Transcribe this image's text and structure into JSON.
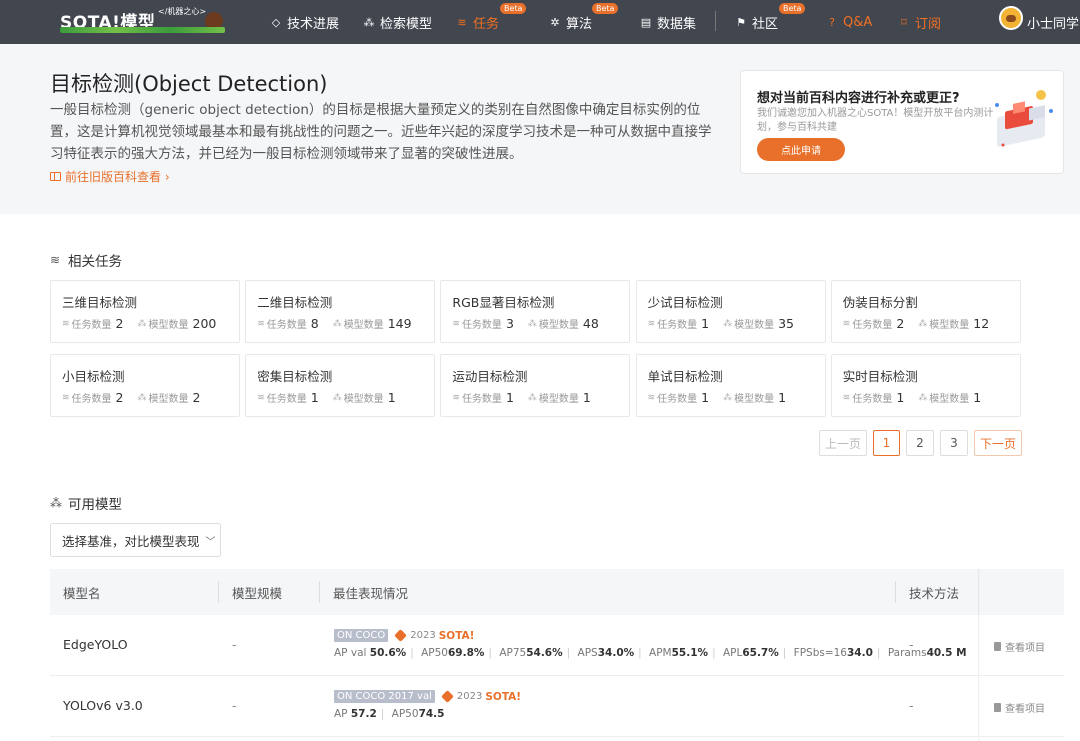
{
  "nav": {
    "logo": "SOTA!模型",
    "logo_sub": "</机器之心>",
    "items": [
      {
        "label": "技术进展",
        "icon": "diamond-icon"
      },
      {
        "label": "检索模型",
        "icon": "nodes-icon"
      },
      {
        "label": "任务",
        "icon": "layers-icon",
        "badge": "Beta"
      },
      {
        "label": "算法",
        "icon": "algorithm-icon",
        "badge": "Beta"
      },
      {
        "label": "数据集",
        "icon": "database-icon"
      },
      {
        "label": "社区",
        "icon": "flag-icon",
        "badge": "Beta"
      },
      {
        "label": "Q&A",
        "icon": "qa-icon"
      },
      {
        "label": "订阅",
        "icon": "bookmark-icon"
      }
    ],
    "user": "小士同学"
  },
  "hero": {
    "title": "目标检测(Object Detection)",
    "description": "一般目标检测（generic object detection）的目标是根据大量预定义的类别在自然图像中确定目标实例的位置，这是计算机视觉领域最基本和最有挑战性的问题之一。近些年兴起的深度学习技术是一种可从数据中直接学习特征表示的强大方法，并已经为一般目标检测领域带来了显著的突破性进展。",
    "legacy_link": "前往旧版百科查看 ›"
  },
  "promo": {
    "title": "想对当前百科内容进行补充或更正?",
    "text": "我们诚邀您加入机器之心SOTA！模型开放平台内测计划，参与百科共建",
    "button": "点此申请"
  },
  "related": {
    "title": "相关任务",
    "task_count_label": "任务数量",
    "model_count_label": "模型数量",
    "tasks": [
      {
        "name": "三维目标检测",
        "tasks": "2",
        "models": "200"
      },
      {
        "name": "二维目标检测",
        "tasks": "8",
        "models": "149"
      },
      {
        "name": "RGB显著目标检测",
        "tasks": "3",
        "models": "48"
      },
      {
        "name": "少试目标检测",
        "tasks": "1",
        "models": "35"
      },
      {
        "name": "伪装目标分割",
        "tasks": "2",
        "models": "12"
      },
      {
        "name": "小目标检测",
        "tasks": "2",
        "models": "2"
      },
      {
        "name": "密集目标检测",
        "tasks": "1",
        "models": "1"
      },
      {
        "name": "运动目标检测",
        "tasks": "1",
        "models": "1"
      },
      {
        "name": "单试目标检测",
        "tasks": "1",
        "models": "1"
      },
      {
        "name": "实时目标检测",
        "tasks": "1",
        "models": "1"
      }
    ],
    "pagination": {
      "prev": "上一页",
      "pages": [
        "1",
        "2",
        "3"
      ],
      "current": "1",
      "next": "下一页"
    }
  },
  "models": {
    "title": "可用模型",
    "select_label": "选择基准，对比模型表现",
    "columns": [
      "模型名",
      "模型规模",
      "最佳表现情况",
      "技术方法"
    ],
    "rows": [
      {
        "name": "EdgeYOLO",
        "scale": "-",
        "dataset": "ON COCO",
        "year": "2023",
        "sota": "SOTA!",
        "metrics": [
          {
            "k": "AP val ",
            "v": "50.6%"
          },
          {
            "k": "AP50",
            "v": "69.8%"
          },
          {
            "k": "AP75",
            "v": "54.6%"
          },
          {
            "k": "APS",
            "v": "34.0%"
          },
          {
            "k": "APM",
            "v": "55.1%"
          },
          {
            "k": "APL",
            "v": "65.7%"
          },
          {
            "k": "FPSbs=16",
            "v": "34.0"
          },
          {
            "k": "Params",
            "v": "40.5 M"
          }
        ],
        "method": "-",
        "action": "查看项目"
      },
      {
        "name": "YOLOv6 v3.0",
        "scale": "-",
        "dataset": "ON COCO 2017 val",
        "year": "2023",
        "sota": "SOTA!",
        "metrics": [
          {
            "k": "AP ",
            "v": "57.2"
          },
          {
            "k": "AP50",
            "v": "74.5"
          }
        ],
        "method": "-",
        "action": "查看项目"
      }
    ]
  },
  "colors": {
    "accent": "#e8702a",
    "nav_bg": "#41464f"
  }
}
